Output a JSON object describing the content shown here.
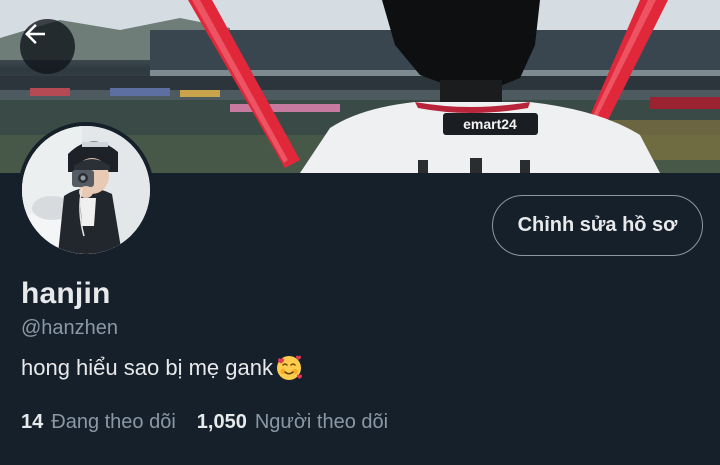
{
  "header": {
    "back_icon": "arrow-left-icon",
    "banner_sponsor_text": "emart24"
  },
  "profile": {
    "display_name": "hanjin",
    "handle": "@hanzhen",
    "bio_text": "hong hiểu sao bị mẹ gank",
    "bio_emoji": "smiling-face-with-hearts-emoji",
    "edit_button_label": "Chỉnh sửa hồ sơ"
  },
  "stats": {
    "following_count": "14",
    "following_label": "Đang theo dõi",
    "followers_count": "1,050",
    "followers_label": "Người theo dõi"
  },
  "colors": {
    "background": "#15202b",
    "primary_text": "#e7e9ea",
    "secondary_text": "#8b98a5",
    "button_border": "#8b98a5"
  }
}
